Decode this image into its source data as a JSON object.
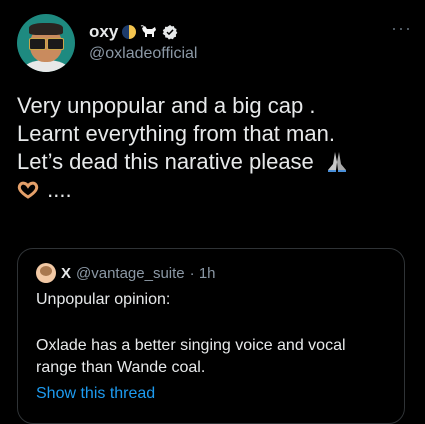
{
  "author": {
    "display_name": "oxy",
    "handle": "@oxladeofficial",
    "name_emojis": [
      "moon-icon",
      "goat-icon"
    ],
    "verified_color": "#1d9bf0"
  },
  "more_label": "···",
  "tweet": {
    "lines": [
      "Very unpopular and a big cap .",
      "Learnt everything from that man.",
      "Let’s dead this narative please",
      "...."
    ]
  },
  "quoted": {
    "display_name": "X",
    "handle": "@vantage_suite",
    "time": "· 1h",
    "line1": "Unpopular opinion:",
    "body": "Oxlade has a better singing voice and vocal range than Wande coal.",
    "show_thread": "Show this thread"
  },
  "colors": {
    "background": "#000000",
    "text": "#e7e9ea",
    "muted": "#8b98a5",
    "link": "#1d9bf0",
    "border": "#2f3336"
  }
}
